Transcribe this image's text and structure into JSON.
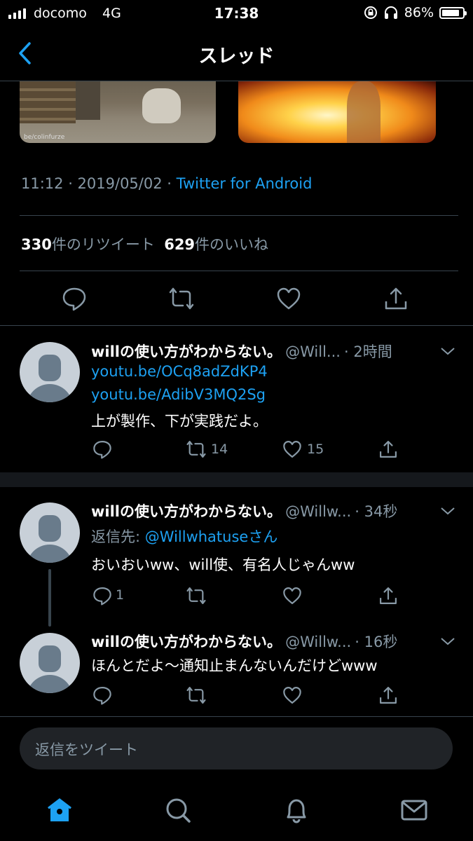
{
  "status": {
    "carrier": "docomo",
    "network": "4G",
    "time": "17:38",
    "battery": "86%"
  },
  "header": {
    "title": "スレッド"
  },
  "media": {
    "watermark": "be/colinfurze"
  },
  "tweet_meta": {
    "time": "11:12 · 2019/05/02 · ",
    "source": "Twitter for Android"
  },
  "stats": {
    "retweets_num": "330",
    "retweets_label": "件のリツイート",
    "likes_num": "629",
    "likes_label": "件のいいね"
  },
  "replies": [
    {
      "name": "willの使い方がわからない。",
      "handle": "@Will...",
      "time": "· 2時間",
      "links": [
        "youtu.be/OCq8adZdKP4",
        "youtu.be/AdibV3MQ2Sg"
      ],
      "text": "上が製作、下が実践だよ。",
      "reply_count": "",
      "retweet_count": "14",
      "like_count": "15"
    },
    {
      "name": "willの使い方がわからない。",
      "handle": "@Willw...",
      "time": "· 34秒",
      "reply_to_label": "返信先: ",
      "reply_to_user": "@Willwhatuseさん",
      "text": "おいおいww、will使、有名人じゃんww",
      "reply_count": "1",
      "retweet_count": "",
      "like_count": ""
    },
    {
      "name": "willの使い方がわからない。",
      "handle": "@Willw...",
      "time": "· 16秒",
      "text": "ほんとだよ〜通知止まんないんだけどwww",
      "reply_count": "",
      "retweet_count": "",
      "like_count": ""
    }
  ],
  "reply_bar": {
    "placeholder": "返信をツイート"
  },
  "colors": {
    "accent": "#1da1f2",
    "background": "#000000",
    "muted": "#8899a6",
    "divider": "#38444d"
  },
  "tabs": [
    "home-icon",
    "search-icon",
    "notifications-icon",
    "messages-icon"
  ]
}
